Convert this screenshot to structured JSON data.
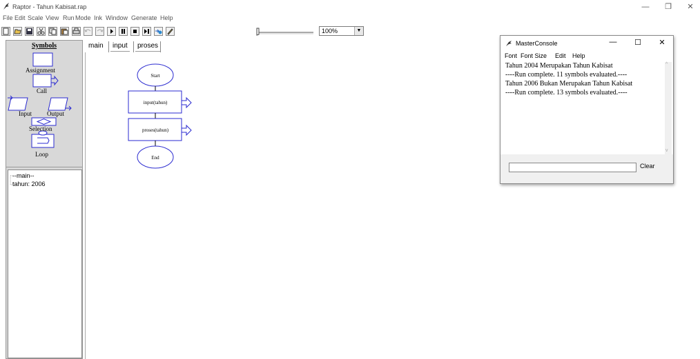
{
  "window": {
    "title": "Raptor - Tahun Kabisat.rap",
    "minimize": "—",
    "restore": "❐",
    "close": "✕"
  },
  "menubar": {
    "items": [
      "File",
      "Edit",
      "Scale",
      "View",
      "Run",
      "Mode",
      "Ink",
      "Window",
      "Generate",
      "Help"
    ]
  },
  "toolbar": {
    "zoom": "100%",
    "buttons": [
      "new-file-icon",
      "open-icon",
      "save-icon",
      "cut-icon",
      "copy-icon",
      "paste-icon",
      "print-icon",
      "undo-icon",
      "redo-icon",
      "play-icon",
      "pause-icon",
      "stop-icon",
      "step-icon",
      "breakpoint-icon",
      "pen-icon"
    ]
  },
  "symbols": {
    "title": "Symbols",
    "assignment": "Assignment",
    "call": "Call",
    "input": "Input",
    "output": "Output",
    "selection": "Selection",
    "loop": "Loop"
  },
  "variables": {
    "root": "--main--",
    "item": "tahun: 2006"
  },
  "tabs": [
    "main",
    "input",
    "proses"
  ],
  "flowchart": {
    "start": "Start",
    "call1": "input(tahun)",
    "call2": "proses(tahun)",
    "end": "End"
  },
  "console": {
    "title": "MasterConsole",
    "menu": [
      "Font",
      "Font Size",
      "Edit",
      "Help"
    ],
    "lines": [
      "Tahun 2004 Merupakan Tahun Kabisat",
      "----Run complete.  11 symbols evaluated.----",
      "Tahun 2006 Bukan Merupakan Tahun Kabisat",
      "----Run complete.  13 symbols evaluated.----"
    ],
    "clear": "Clear",
    "minimize": "—",
    "maximize": "☐",
    "close": "✕"
  },
  "colors": {
    "flow_blue": "#2a2ad0",
    "panel_gray": "#d8d8d8"
  }
}
